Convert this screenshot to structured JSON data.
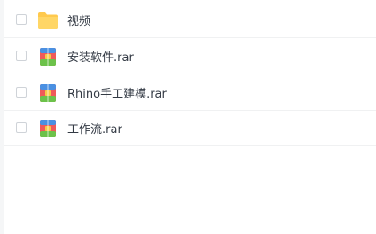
{
  "files": [
    {
      "name": "视频",
      "icon": "folder-icon",
      "type": "folder"
    },
    {
      "name": "安装软件.rar",
      "icon": "rar-archive-icon",
      "type": "rar"
    },
    {
      "name": "Rhino手工建模.rar",
      "icon": "rar-archive-icon",
      "type": "rar"
    },
    {
      "name": "工作流.rar",
      "icon": "rar-archive-icon",
      "type": "rar"
    }
  ],
  "colors": {
    "folder": "#ffc94d",
    "rar_red": "#ef5a5a",
    "rar_green": "#6cc24a",
    "rar_blue": "#4a90e2",
    "rar_yellow": "#f7c948"
  }
}
